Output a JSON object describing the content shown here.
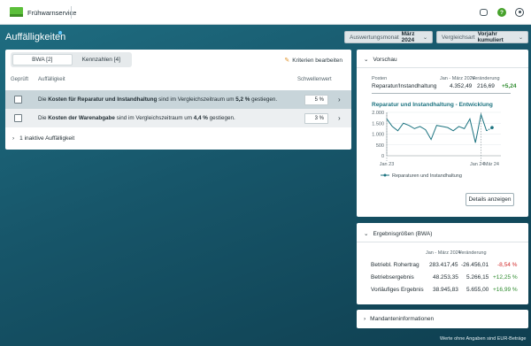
{
  "app": {
    "title": "Frühwarnservice"
  },
  "page": {
    "title": "Auffälligkeiten"
  },
  "header": {
    "month_label": "Auswertungsmonat",
    "month_value": "März 2024",
    "compare_label": "Vergleichsart",
    "compare_value": "Vorjahr kumuliert"
  },
  "tabs": [
    {
      "label": "BWA [2]"
    },
    {
      "label": "Kennzahlen [4]"
    }
  ],
  "edit_criteria": "Kriterien bearbeiten",
  "columns": {
    "checked": "Geprüft",
    "anomaly": "Auffälligkeit",
    "threshold": "Schwellenwert"
  },
  "anomalies": [
    {
      "pre": "Die ",
      "bold": "Kosten für Reparatur und Instandhaltung",
      "mid": " sind im Vergleichszeitraum um ",
      "pct": "5,2 %",
      "post": " gestiegen.",
      "threshold": "5 %"
    },
    {
      "pre": "Die ",
      "bold": "Kosten der Warenabgabe",
      "mid": " sind im Vergleichszeitraum um ",
      "pct": "4,4 %",
      "post": " gestiegen.",
      "threshold": "3 %"
    }
  ],
  "inactive": "1 inaktive Auffälligkeit",
  "preview": {
    "heading": "Vorschau",
    "col_item": "Posten",
    "col_period": "Jan - März 2024",
    "col_change": "Veränderung",
    "item": "Reparatur/Instandhaltung",
    "value": "4.352,49",
    "change_abs": "216,69",
    "change_pct": "+5,24",
    "details_button": "Details anzeigen"
  },
  "chart_data": {
    "type": "line",
    "title": "Reparatur und Instandhaltung - Entwicklung",
    "series": [
      {
        "name": "Reparaturen und Instandhaltung",
        "values": [
          1700,
          1350,
          1150,
          1500,
          1400,
          1250,
          1350,
          1200,
          750,
          1400,
          1350,
          1300,
          1150,
          1350,
          1250,
          1700,
          600,
          1900,
          1150,
          1300
        ]
      }
    ],
    "x_labels": [
      "Jan 23",
      "Jan 24",
      "Mär 24"
    ],
    "yticks": [
      "2.000",
      "1.500",
      "1.000",
      "500",
      "0"
    ],
    "ylim": [
      0,
      2000
    ],
    "color": "#1c7380"
  },
  "results": {
    "heading": "Ergebnisgrößen (BWA)",
    "col_period": "Jan - März 2024",
    "col_change": "Veränderung",
    "rows": [
      {
        "label": "Betriebl. Rohertrag",
        "value": "283.417,45",
        "change": "-26.456,01",
        "pct": "-8,54 %",
        "trend": "neg"
      },
      {
        "label": "Betriebsergebnis",
        "value": "48.253,35",
        "change": "5.266,15",
        "pct": "+12,25 %",
        "trend": "pos"
      },
      {
        "label": "Vorläufiges Ergebnis",
        "value": "38.945,83",
        "change": "5.655,00",
        "pct": "+16,99 %",
        "trend": "pos"
      }
    ]
  },
  "mandant": {
    "heading": "Mandanteninformationen"
  },
  "footer": "Werte ohne Angaben sind EUR-Beträge"
}
